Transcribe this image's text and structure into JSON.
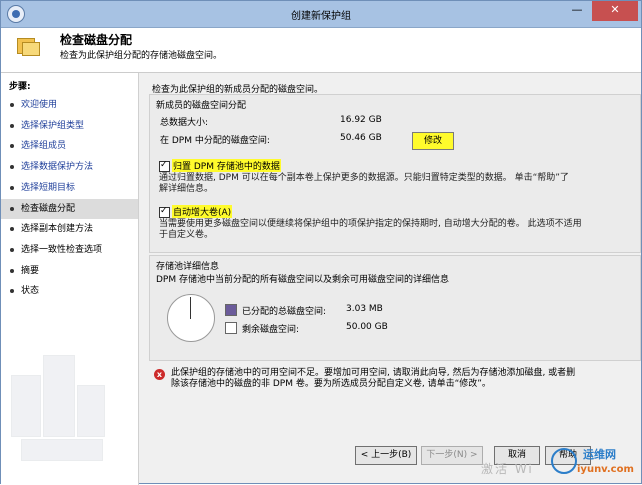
{
  "window": {
    "title": "创建新保护组",
    "min_glyph": "—",
    "close_glyph": "✕"
  },
  "header": {
    "title": "检查磁盘分配",
    "subtitle": "检查为此保护组分配的存储池磁盘空间。"
  },
  "steps": {
    "title": "步骤:",
    "items": [
      {
        "label": "欢迎使用",
        "state": "link"
      },
      {
        "label": "选择保护组类型",
        "state": "link"
      },
      {
        "label": "选择组成员",
        "state": "link"
      },
      {
        "label": "选择数据保护方法",
        "state": "link"
      },
      {
        "label": "选择短期目标",
        "state": "link"
      },
      {
        "label": "检查磁盘分配",
        "state": "current"
      },
      {
        "label": "选择副本创建方法",
        "state": "normal"
      },
      {
        "label": "选择一致性检查选项",
        "state": "normal"
      },
      {
        "label": "摘要",
        "state": "normal"
      },
      {
        "label": "状态",
        "state": "normal"
      }
    ]
  },
  "main": {
    "intro": "检查为此保护组的新成员分配的磁盘空间。",
    "new_member": {
      "title": "新成员的磁盘空间分配",
      "total_label": "总数据大小:",
      "total_value": "16.92 GB",
      "dpm_label": "在 DPM 中分配的磁盘空间:",
      "dpm_value": "50.46 GB",
      "modify_label": "修改",
      "collocate_label": "归置 DPM 存储池中的数据",
      "collocate_desc_1": "通过归置数据, DPM 可以在每个副本卷上保护更多的数据源。只能归置特定类型的数据。 单击“帮助”了",
      "collocate_desc_2": "解详细信息。",
      "autogrow_label": "自动增大卷(A)",
      "autogrow_desc_1": "当需要使用更多磁盘空间以便继续将保护组中的项保护指定的保持期时, 自动增大分配的卷。 此选项不适用",
      "autogrow_desc_2": "于自定义卷。"
    },
    "pool": {
      "title": "存储池详细信息",
      "desc": "DPM 存储池中当前分配的所有磁盘空间以及剩余可用磁盘空间的详细信息",
      "allocated_label": "已分配的总磁盘空间:",
      "allocated_value": "3.03 MB",
      "allocated_color": "#6b5b9a",
      "free_label": "剩余磁盘空间:",
      "free_value": "50.00 GB",
      "free_color": "#ffffff"
    },
    "error": {
      "icon": "x",
      "line1": "此保护组的存储池中的可用空间不足。要增加可用空间, 请取消此向导, 然后为存储池添加磁盘, 或者删",
      "line2": "除该存储池中的磁盘的非 DPM 卷。要为所选成员分配自定义卷, 请单击“修改”。"
    }
  },
  "footer": {
    "back": "< 上一步(B)",
    "next": "下一步(N) >",
    "cancel": "取消",
    "help": "帮助"
  },
  "overlay": {
    "site_top": "运维网",
    "site_bottom": "iyunv.com",
    "activate": "激活 Wi"
  }
}
